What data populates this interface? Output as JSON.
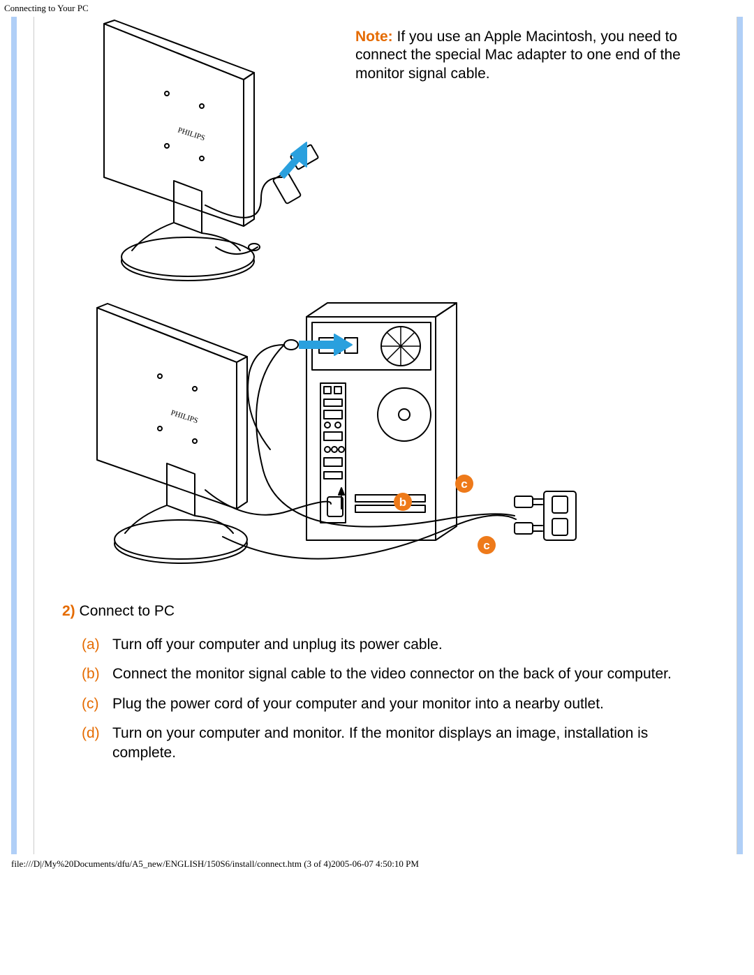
{
  "header": {
    "title": "Connecting to Your PC"
  },
  "note": {
    "label": "Note:",
    "text": " If you use an Apple Macintosh, you need to connect the special Mac adapter to one end of the monitor signal cable."
  },
  "section": {
    "number": "2)",
    "title": " Connect to PC"
  },
  "steps": [
    {
      "letter": "(a)",
      "text": "Turn off your computer and unplug its power cable."
    },
    {
      "letter": "(b)",
      "text": "Connect the monitor signal cable to the video connector on the back of your computer."
    },
    {
      "letter": "(c)",
      "text": "Plug the power cord of your computer and your monitor into a nearby outlet."
    },
    {
      "letter": "(d)",
      "text": "Turn on your computer and monitor. If the monitor displays an image, installation is complete."
    }
  ],
  "callouts": {
    "b": "b",
    "c1": "c",
    "c2": "c"
  },
  "brand": "PHILIPS",
  "footer": {
    "text": "file:///D|/My%20Documents/dfu/A5_new/ENGLISH/150S6/install/connect.htm (3 of 4)2005-06-07 4:50:10 PM"
  }
}
